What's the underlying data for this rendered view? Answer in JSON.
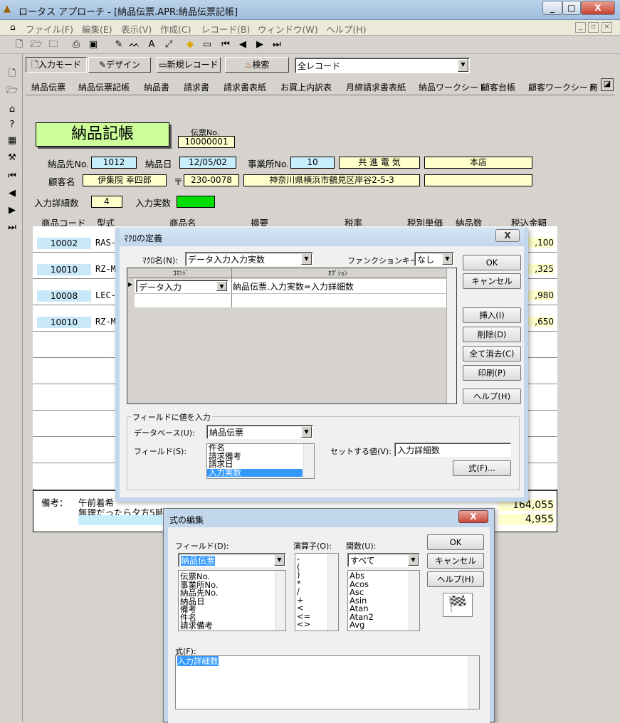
{
  "window": {
    "title": "ロータス アプローチ - [納品伝票.APR:納品伝票記帳]",
    "min": "_",
    "max": "□",
    "close": "X"
  },
  "menu": [
    "ファイル(F)",
    "編集(E)",
    "表示(V)",
    "作成(C)",
    "レコード(B)",
    "ウィンドウ(W)",
    "ヘルプ(H)"
  ],
  "menu_controls": {
    "min": "_",
    "restore": "▫",
    "close": "×"
  },
  "modebar": {
    "input_mode": "入力モード",
    "design": "デザイン",
    "new_record": "新規レコード",
    "search": "検索",
    "record_filter": "全レコード"
  },
  "tabs": [
    "納品伝票",
    "納品伝票記帳",
    "納品書",
    "請求書",
    "請求書表紙",
    "お買上内訳表",
    "月締請求書表紙",
    "納品ワークシート",
    "顧客台帳",
    "顧客ワークシート",
    "商"
  ],
  "form": {
    "title": "納品記帳",
    "slip_no_label": "伝票No.",
    "slip_no": "10000001",
    "dest_no_label": "納品先No.",
    "dest_no": "1012",
    "date_label": "納品日",
    "date": "12/05/02",
    "office_no_label": "事業所No.",
    "office_no": "10",
    "company": "共 進 電 気",
    "branch": "本店",
    "customer_label": "顧客名",
    "customer": "伊集院 幸四郎",
    "postal_mark": "〒",
    "postal": "230-0078",
    "address": "神奈川県横浜市鶴見区岸谷2-5-3",
    "detail_count_label": "入力詳細数",
    "detail_count": "4",
    "actual_count_label": "入力実数",
    "columns": [
      "商品コード",
      "型式",
      "商品名",
      "摘要",
      "税率",
      "税別単価",
      "納品数",
      "税込金額"
    ],
    "rows": [
      {
        "code": "10002",
        "model": "RAS-",
        "amount": ",100"
      },
      {
        "code": "10010",
        "model": "RZ-M",
        "amount": ",325"
      },
      {
        "code": "10008",
        "model": "LEC-",
        "amount": ",980"
      },
      {
        "code": "10010",
        "model": "RZ-M",
        "amount": ",650"
      }
    ],
    "remarks_label": "備考：",
    "remark1": "午前着希",
    "remark2": "無理だったら夕方5時以降",
    "total1": "164,055",
    "total2": "4,955"
  },
  "macro_dialog": {
    "title": "ﾏｸﾛの定義",
    "close": "X",
    "name_label": "ﾏｸﾛ名(N):",
    "name": "データ入力入力実数",
    "fkey_label": "ファンクションキー(K):",
    "fkey": "なし",
    "col_command": "ｺﾏﾝﾄﾞ",
    "col_option": "ｵﾌﾟｼｮﾝ",
    "command": "データ入力",
    "option": "納品伝票.入力実数=入力詳細数",
    "ok": "OK",
    "cancel": "キャンセル",
    "insert": "挿入(I)",
    "delete": "削除(D)",
    "clear_all": "全て消去(C)",
    "print": "印刷(P)",
    "help": "ヘルプ(H)",
    "group_label": "フィールドに値を入力",
    "db_label": "データベース(U):",
    "db": "納品伝票",
    "field_label": "フィールド(S):",
    "fields": [
      "件名",
      "請求備考",
      "請求日",
      "入力実数"
    ],
    "set_value_label": "セットする値(V):",
    "set_value": "入力詳細数",
    "formula_btn": "式(F)..."
  },
  "formula_dialog": {
    "title": "式の編集",
    "close": "X",
    "field_label": "フィールド(D):",
    "field_db": "納品伝票",
    "fields": [
      "伝票No.",
      "事業所No.",
      "納品先No.",
      "納品日",
      "備考",
      "件名",
      "請求備考"
    ],
    "operator_label": "演算子(O):",
    "operators": [
      "-",
      "(",
      ")",
      "*",
      "/",
      "+",
      "<",
      "<=",
      "<>"
    ],
    "function_label": "関数(U):",
    "function_filter": "すべて",
    "functions": [
      "Abs",
      "Acos",
      "Asc",
      "Asin",
      "Atan",
      "Atan2",
      "Avg"
    ],
    "ok": "OK",
    "cancel": "キャンセル",
    "help": "ヘルプ(H)",
    "formula_label": "式(F):",
    "formula": "入力詳細数"
  },
  "colors": {
    "title_green": "#ccff99",
    "highlight": "#3399ff",
    "green_box": "#00dd00"
  }
}
